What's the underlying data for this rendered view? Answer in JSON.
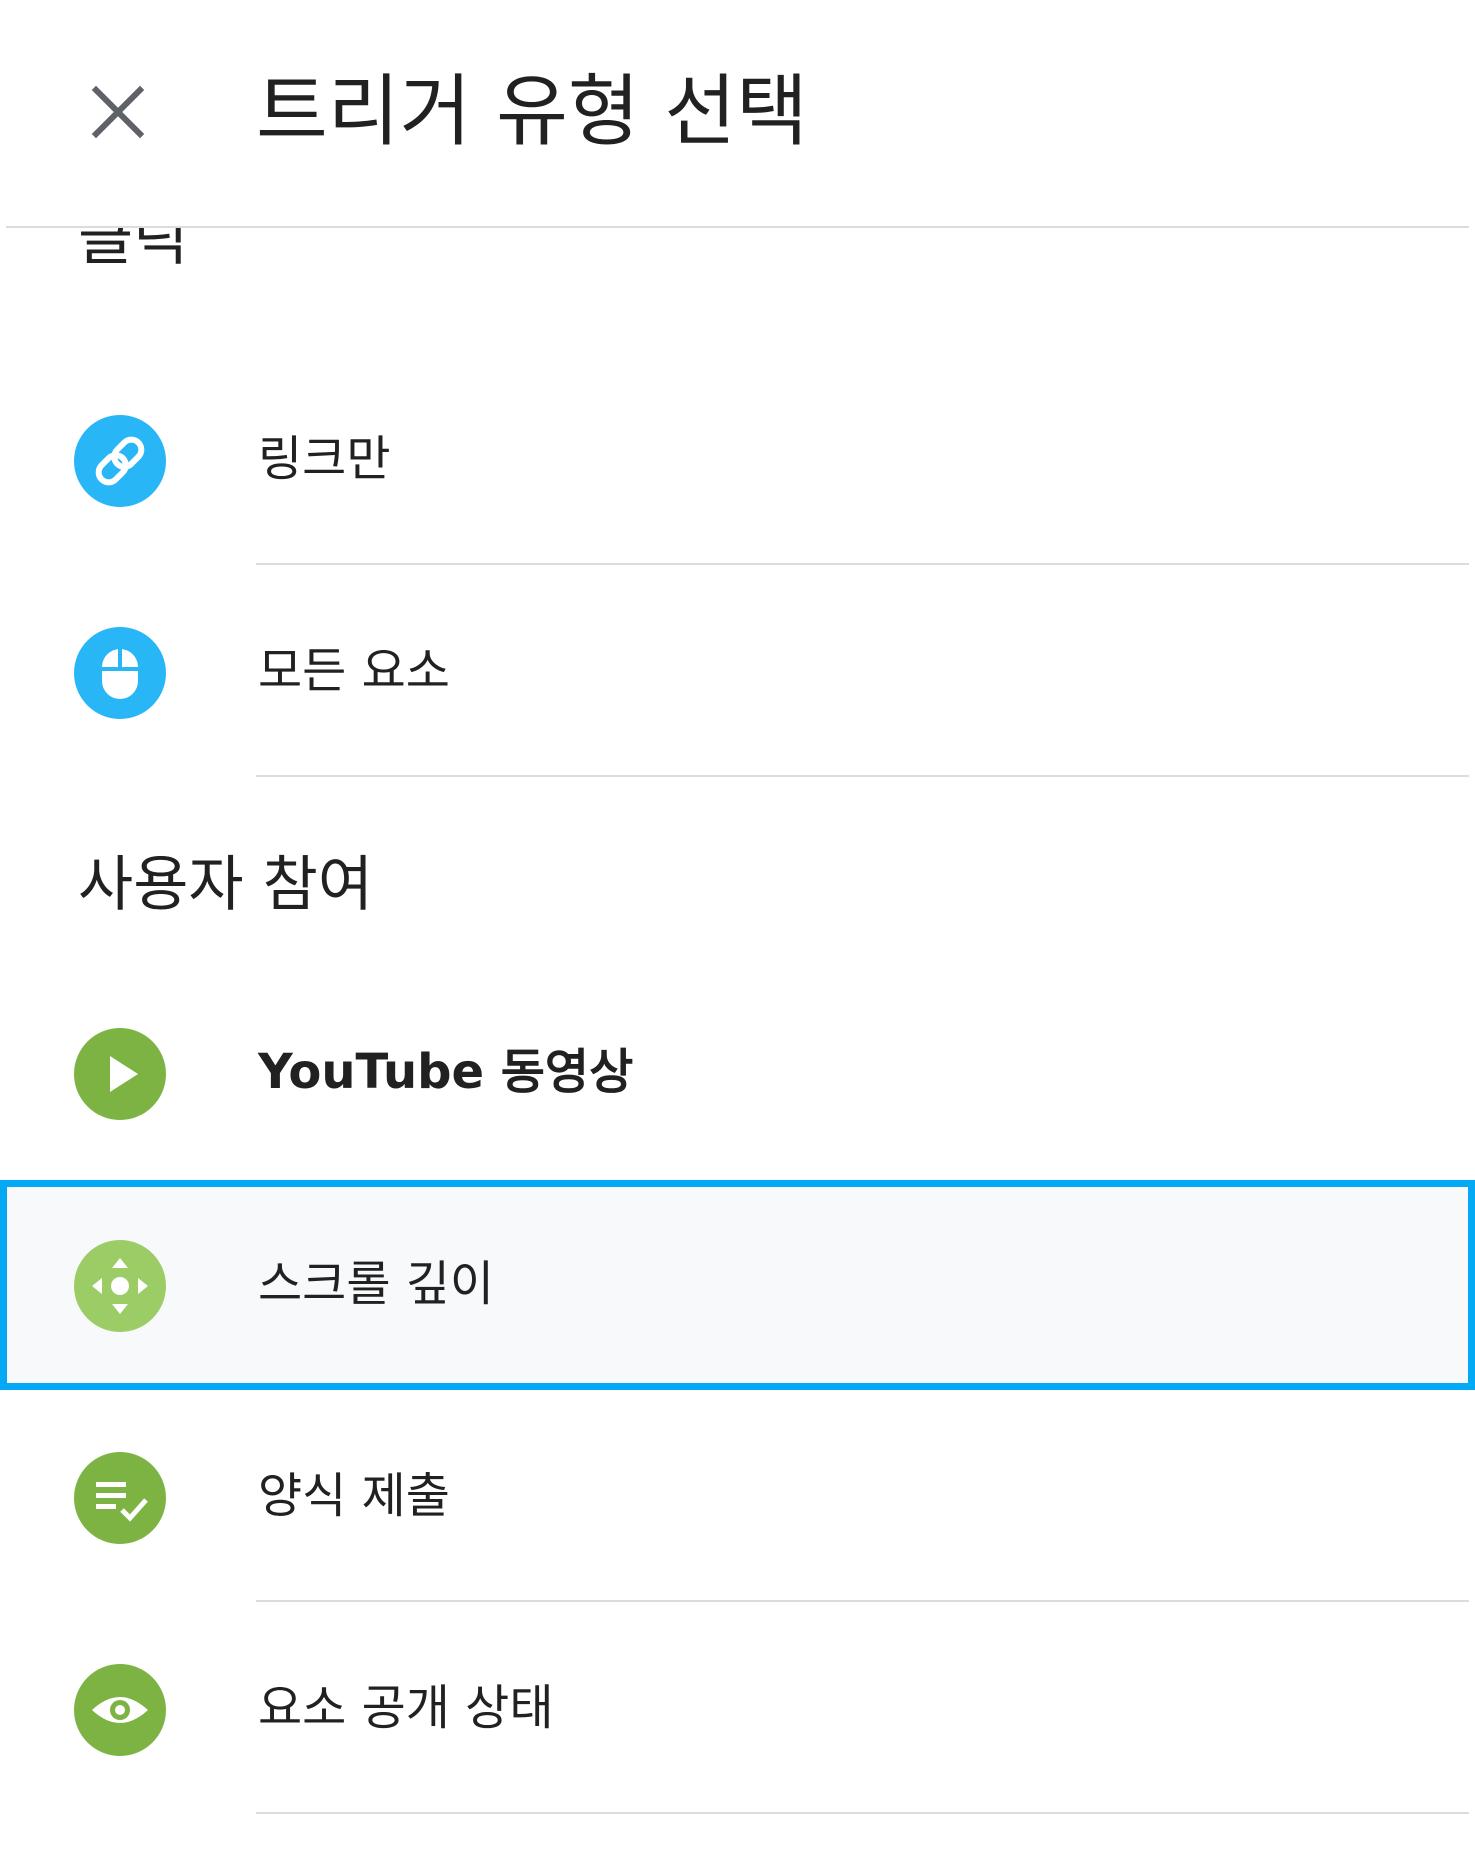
{
  "header": {
    "title": "트리거 유형 선택",
    "close_icon": "close-icon"
  },
  "sections": [
    {
      "title": "클릭",
      "items": [
        {
          "label": "링크만",
          "icon": "link-icon",
          "color": "#29b6f6"
        },
        {
          "label": "모든 요소",
          "icon": "mouse-icon",
          "color": "#29b6f6"
        }
      ]
    },
    {
      "title": "사용자 참여",
      "items": [
        {
          "label": "YouTube 동영상",
          "icon": "play-icon",
          "color": "#7cb342"
        },
        {
          "label": "스크롤 깊이",
          "icon": "scroll-move-icon",
          "color": "#9ccc65",
          "selected": true
        },
        {
          "label": "양식 제출",
          "icon": "form-check-icon",
          "color": "#7cb342"
        },
        {
          "label": "요소 공개 상태",
          "icon": "eye-icon",
          "color": "#7cb342"
        }
      ]
    }
  ],
  "colors": {
    "selection_border": "#03a9f4",
    "divider": "#dadce0"
  }
}
